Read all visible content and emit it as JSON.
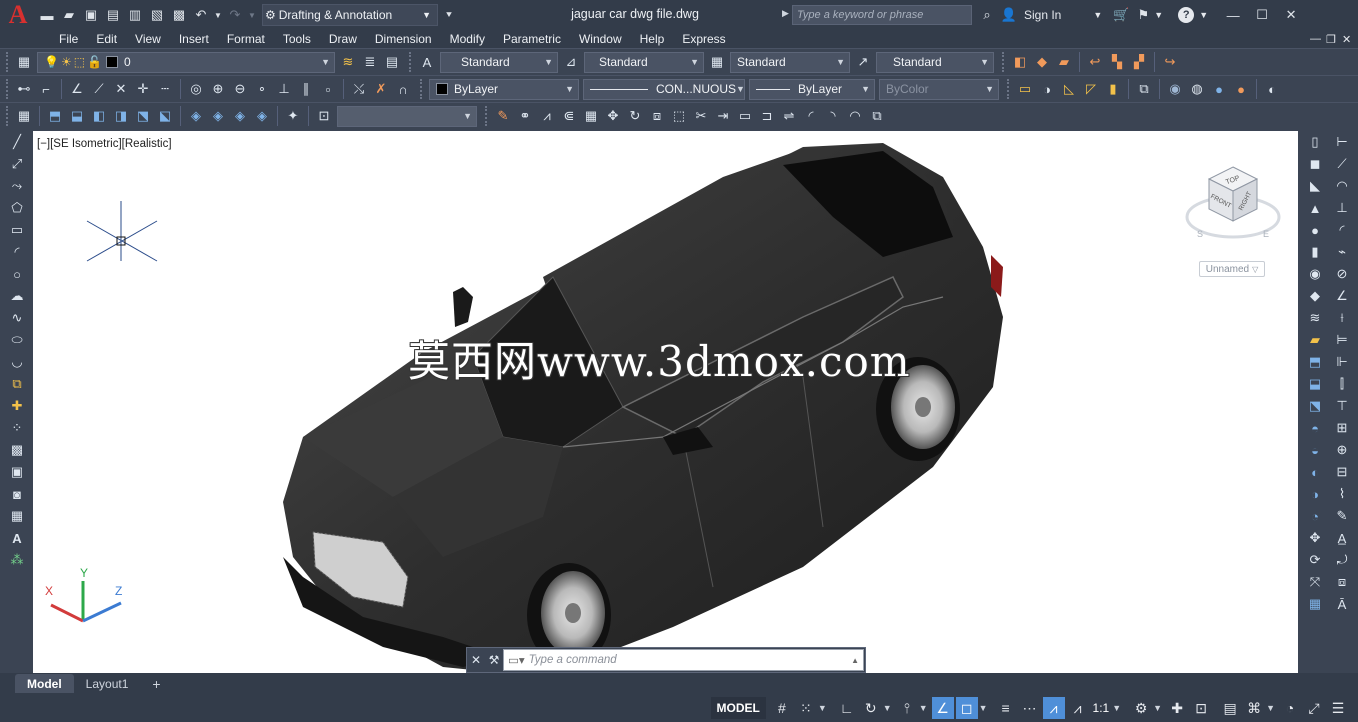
{
  "app": {
    "logo": "A",
    "workspace": "Drafting & Annotation",
    "document_title": "jaguar car dwg file.dwg",
    "search_placeholder": "Type a keyword or phrase",
    "sign_in": "Sign In"
  },
  "menu": [
    "File",
    "Edit",
    "View",
    "Insert",
    "Format",
    "Tools",
    "Draw",
    "Dimension",
    "Modify",
    "Parametric",
    "Window",
    "Help",
    "Express"
  ],
  "toolbar1": {
    "layer": "0",
    "text_style": "Standard",
    "dim_style": "Standard",
    "table_style": "Standard",
    "mleader_style": "Standard"
  },
  "toolbar2": {
    "color": "ByLayer",
    "linetype": "CON...NUOUS",
    "lineweight": "ByLayer",
    "plotstyle": "ByColor"
  },
  "viewport": {
    "label": "[−][SE Isometric][Realistic]",
    "watermark": "莫西网www.3dmox.com",
    "viewcube_top": "TOP",
    "viewcube_front": "FRONT",
    "viewcube_right": "RIGHT",
    "viewcube_s": "S",
    "viewcube_e": "E",
    "ucs_name": "Unnamed",
    "axis_x": "X",
    "axis_y": "Y",
    "axis_z": "Z"
  },
  "command": {
    "placeholder": "Type a command"
  },
  "tabs": [
    "Model",
    "Layout1",
    "+"
  ],
  "status": {
    "model": "MODEL",
    "scale": "1:1"
  }
}
